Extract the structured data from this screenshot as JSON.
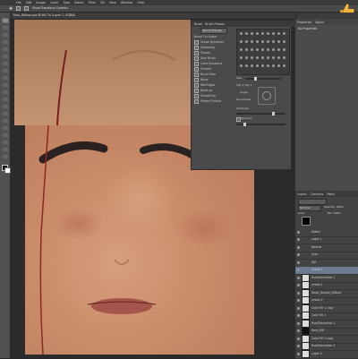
{
  "menubar": [
    "File",
    "Edit",
    "Image",
    "Layer",
    "Type",
    "Select",
    "Filter",
    "3D",
    "View",
    "Window",
    "Help"
  ],
  "options_label": "Show Transform Controls",
  "doc_tab": "Face_Diffuse.psd @ 66.7% (Layer 1, RGB/8)",
  "brush_panel": {
    "tabs": [
      "Brush",
      "Brush Presets"
    ],
    "preset_button": "Brush Presets",
    "options": [
      "Brush Tip Shape",
      "Shape Dynamics",
      "Scattering",
      "Texture",
      "Dual Brush",
      "Color Dynamics",
      "Transfer",
      "Brush Pose",
      "Noise",
      "Wet Edges",
      "Build-up",
      "Smoothing",
      "Protect Texture"
    ],
    "size_label": "Size",
    "flip_label": "Flip X  Flip Y",
    "angle_label": "Angle",
    "roundness_label": "Roundness",
    "hardness_label": "Hardness",
    "spacing_label": "Spacing"
  },
  "properties": {
    "tabs": [
      "Properties",
      "Adjust"
    ],
    "title": "No Properties"
  },
  "layers": {
    "tabs": [
      "Layers",
      "Channels",
      "Paths"
    ],
    "blend_mode": "Normal",
    "opacity_label": "Opacity: 100%",
    "fill_label": "Fill: 100%",
    "lock_label": "Lock:",
    "rows": [
      {
        "name": "Sketch",
        "thumb": "none"
      },
      {
        "name": "Layer 1",
        "thumb": "none"
      },
      {
        "name": "Normal",
        "thumb": "none"
      },
      {
        "name": "Eyes",
        "thumb": "none"
      },
      {
        "name": "Diff",
        "thumb": "none"
      },
      {
        "name": "Group 1",
        "thumb": "none",
        "selected": true
      },
      {
        "name": "Hue/Saturation 1",
        "thumb": "light"
      },
      {
        "name": "Levels 1",
        "thumb": "light"
      },
      {
        "name": "Head_Texture_Diffuse",
        "thumb": "light"
      },
      {
        "name": "Levels 2",
        "thumb": "light"
      },
      {
        "name": "Color Fill 1 copy",
        "thumb": "light"
      },
      {
        "name": "Color Fill 1",
        "thumb": "light"
      },
      {
        "name": "Hue/Saturation 2",
        "thumb": "light"
      },
      {
        "name": "Face_Diff",
        "thumb": "dark"
      },
      {
        "name": "Color Fill 2 copy",
        "thumb": "light"
      },
      {
        "name": "Hue/Saturation 3",
        "thumb": "light"
      },
      {
        "name": "Layer 0",
        "thumb": "light"
      }
    ]
  },
  "colors": {
    "thumbs_up": "#f2b43a",
    "skin": "#c98b68",
    "brow": "#2a2220",
    "lips": "#9e4a44"
  }
}
